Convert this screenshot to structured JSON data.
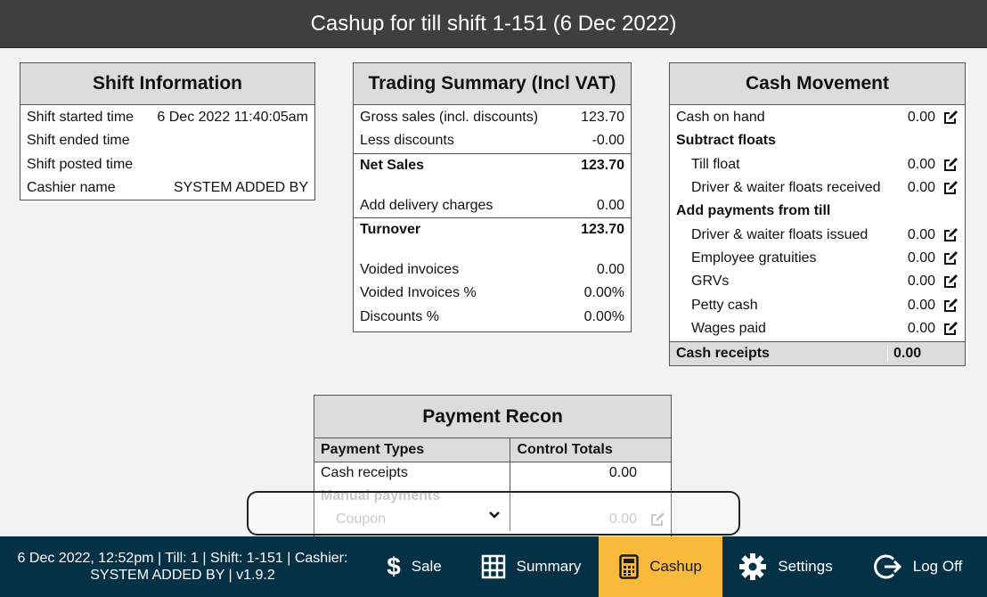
{
  "header": {
    "title": "Cashup for till shift 1-151 (6 Dec 2022)"
  },
  "shift_info": {
    "title": "Shift Information",
    "rows": [
      {
        "label": "Shift started time",
        "value": "6 Dec 2022 11:40:05am"
      },
      {
        "label": "Shift ended time",
        "value": ""
      },
      {
        "label": "Shift posted time",
        "value": ""
      },
      {
        "label": "Cashier name",
        "value": "SYSTEM ADDED BY"
      }
    ]
  },
  "trading": {
    "title": "Trading Summary (Incl VAT)",
    "gross_label": "Gross sales (incl. discounts)",
    "gross_value": "123.70",
    "discounts_label": "Less discounts",
    "discounts_value": "-0.00",
    "net_label": "Net Sales",
    "net_value": "123.70",
    "delivery_label": "Add delivery charges",
    "delivery_value": "0.00",
    "turnover_label": "Turnover",
    "turnover_value": "123.70",
    "voided_label": "Voided invoices",
    "voided_value": "0.00",
    "voided_pct_label": "Voided Invoices %",
    "voided_pct_value": "0.00%",
    "disc_pct_label": "Discounts %",
    "disc_pct_value": "0.00%"
  },
  "cash": {
    "title": "Cash Movement",
    "cash_on_hand_label": "Cash on hand",
    "cash_on_hand_value": "0.00",
    "subtract_heading": "Subtract floats",
    "till_float_label": "Till float",
    "till_float_value": "0.00",
    "driver_received_label": "Driver & waiter floats received",
    "driver_received_value": "0.00",
    "add_heading": "Add payments from till",
    "driver_issued_label": "Driver & waiter floats issued",
    "driver_issued_value": "0.00",
    "gratuities_label": "Employee gratuities",
    "gratuities_value": "0.00",
    "grvs_label": "GRVs",
    "grvs_value": "0.00",
    "petty_label": "Petty cash",
    "petty_value": "0.00",
    "wages_label": "Wages paid",
    "wages_value": "0.00",
    "receipts_label": "Cash receipts",
    "receipts_value": "0.00"
  },
  "recon": {
    "title": "Payment Recon",
    "col1": "Payment Types",
    "col2": "Control Totals",
    "cash_receipts_label": "Cash receipts",
    "cash_receipts_value": "0.00",
    "manual_heading": "Manual payments",
    "coupon_label": "Coupon",
    "coupon_value": "0.00"
  },
  "status": {
    "line1": "6 Dec 2022, 12:52pm | Till: 1 | Shift: 1-151 | Cashier:",
    "line2": "SYSTEM ADDED BY | v1.9.2"
  },
  "nav": {
    "sale": "Sale",
    "summary": "Summary",
    "cashup": "Cashup",
    "settings": "Settings",
    "logoff": "Log Off"
  },
  "colors": {
    "nav_bg": "#043146",
    "active": "#f9b93b",
    "header_bg": "#3f3f3f"
  },
  "icons": [
    "dollar-icon",
    "grid-icon",
    "calculator-icon",
    "gear-icon",
    "logout-icon",
    "edit-icon",
    "chevron-down-icon"
  ]
}
